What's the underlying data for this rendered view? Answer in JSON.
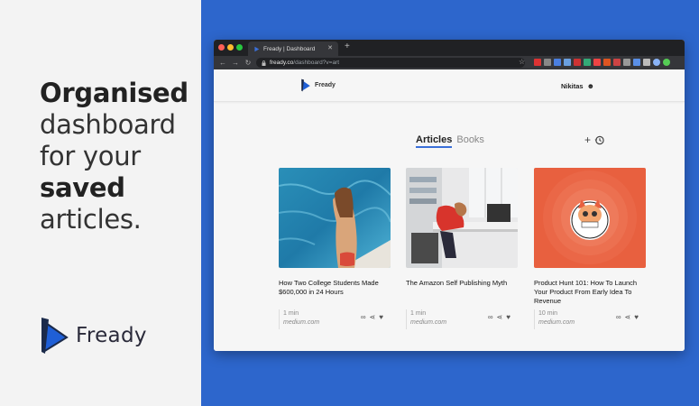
{
  "promo": {
    "headline": {
      "line1": "Organised",
      "line2": "dashboard",
      "line3": "for your",
      "line4": "saved",
      "line5": "articles."
    },
    "brand_name": "Fready"
  },
  "browser": {
    "tab_title": "Fready | Dashboard",
    "url_host": "fready.co",
    "url_path": "/dashboard?v=art"
  },
  "app": {
    "logo_text": "Fready",
    "user_name": "Nikitas",
    "tabs": [
      {
        "label": "Articles",
        "active": true
      },
      {
        "label": "Books",
        "active": false
      }
    ],
    "cards": [
      {
        "title": "How Two College Students Made $600,000 in 24 Hours",
        "time": "1 min",
        "source": "medium.com"
      },
      {
        "title": "The Amazon Self Publishing Myth",
        "time": "1 min",
        "source": "medium.com"
      },
      {
        "title": "Product Hunt 101: How To Launch Your Product From Early Idea To Revenue",
        "time": "10 min",
        "source": "medium.com"
      }
    ]
  },
  "colors": {
    "blue_panel": "#2d66cc",
    "accent": "#3a6fd8",
    "product_hunt_orange": "#e8603f"
  }
}
